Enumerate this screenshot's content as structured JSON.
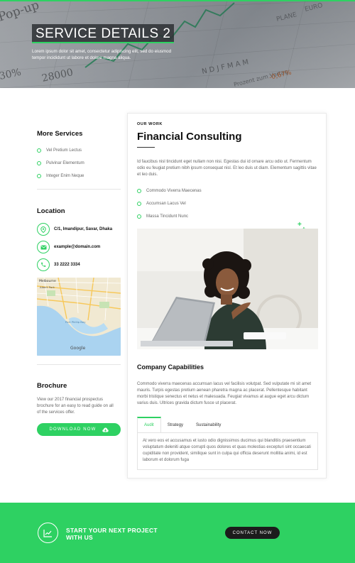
{
  "hero": {
    "title": "SERVICE DETAILS 2",
    "subtitle": "Lorem ipsum dolor sit amet, consectetur adipiscing elit, sed do eiusmod tempor incididunt ut labore et dolore magna aliqua."
  },
  "sidebar": {
    "services_heading": "More Services",
    "services": [
      "Vel Pretium Lectus",
      "Pulvinar Elementum",
      "Integer Enim Neque"
    ],
    "location_heading": "Location",
    "address": "C/1, Imandipur, Savar, Dhaka",
    "email": "example@domain.com",
    "phone": "33 2222 3334",
    "map": {
      "labels": [
        "Melbourne",
        "Albert Park",
        "Port Phillip Bay",
        "Google"
      ]
    },
    "brochure_heading": "Brochure",
    "brochure_text": "View our 2017 financial prospectus brochure for an easy to read guide on all of the services offer.",
    "download_label": "DOWNLOAD NOW"
  },
  "main": {
    "eyebrow": "OUR WORK",
    "title": "Financial Consulting",
    "intro": "Id faucibus nisl tincidunt eget nullam non nisi. Egestas dui id ornare arcu odio ut. Fermentum odio eu feugiat pretium nibh ipsum consequat nisl. Et leo duis ut diam. Elementum sagittis vitae et leo duis.",
    "features": [
      "Commodo Viverra Maecenas",
      "Accumsan Lacus Vel",
      "Massa Tincidunt Nunc"
    ],
    "capabilities_heading": "Company Capabilities",
    "capabilities_text": "Commodo viverra maecenas accumsan lacus vel facilisis volutpat. Sed vulputate mi sit amet mauris. Turpis egestas pretium aenean pharetra magna ac placerat. Pellentesque habitant morbi tristique senectus et netus et malesuada. Feugiat vivamus at augue eget arcu dictum varius duis. Ultrices gravida dictum fusce ut placerat.",
    "tabs": [
      "Audit",
      "Strategy",
      "Sustainability"
    ],
    "tab_content": "At vero eos et accusamus et iusto odio dignissimos ducimus qui blanditiis praesentium voluptatum deleniti atque corrupti quos dolores et quas molestias excepturi sint occaecati cupiditate non provident, similique sunt in culpa qui officia deserunt mollitia animi, id est laborum et dolorum fuga"
  },
  "cta": {
    "text": "START YOUR NEXT PROJECT WITH US",
    "button": "CONTACT NOW"
  },
  "colors": {
    "accent": "#2ed162",
    "dark": "#1c1c1c"
  }
}
